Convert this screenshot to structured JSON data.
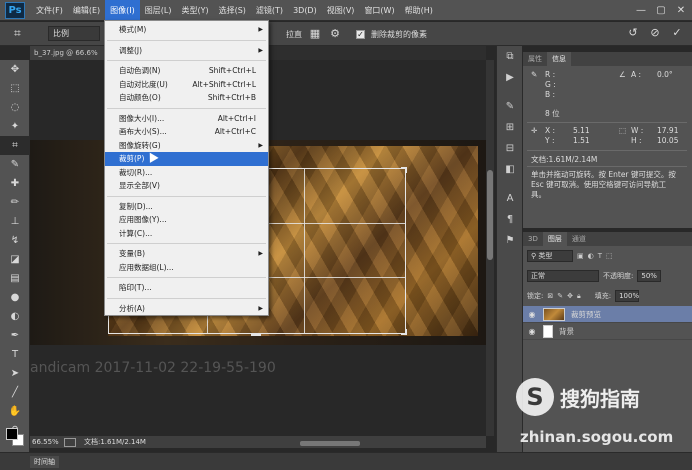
{
  "app": {
    "logo": "Ps"
  },
  "menubar": {
    "items": [
      "文件(F)",
      "编辑(E)",
      "图像(I)",
      "图层(L)",
      "类型(Y)",
      "选择(S)",
      "滤镜(T)",
      "3D(D)",
      "视图(V)",
      "窗口(W)",
      "帮助(H)"
    ],
    "active_index": 2
  },
  "options_bar": {
    "ratio_value": "比例",
    "straighten_label": "拉直",
    "delete_cropped_label": "删除裁剪的像素",
    "delete_cropped_checked": true
  },
  "document": {
    "tab_title": "b_37.jpg @ 66.6%",
    "zoom": "66.55%",
    "doc_info": "文档:1.61M/2.14M",
    "watermark_text": "andicam 2017-11-02 22-19-55-190"
  },
  "image_menu": {
    "items": [
      {
        "label": "模式(M)",
        "submenu": true
      },
      {
        "sep": true
      },
      {
        "label": "调整(J)",
        "submenu": true
      },
      {
        "sep": true
      },
      {
        "label": "自动色调(N)",
        "shortcut": "Shift+Ctrl+L"
      },
      {
        "label": "自动对比度(U)",
        "shortcut": "Alt+Shift+Ctrl+L"
      },
      {
        "label": "自动颜色(O)",
        "shortcut": "Shift+Ctrl+B"
      },
      {
        "sep": true
      },
      {
        "label": "图像大小(I)...",
        "shortcut": "Alt+Ctrl+I"
      },
      {
        "label": "画布大小(S)...",
        "shortcut": "Alt+Ctrl+C"
      },
      {
        "label": "图像旋转(G)",
        "submenu": true
      },
      {
        "label": "裁剪(P)",
        "highlighted": true
      },
      {
        "label": "裁切(R)..."
      },
      {
        "label": "显示全部(V)"
      },
      {
        "sep": true
      },
      {
        "label": "复制(D)..."
      },
      {
        "label": "应用图像(Y)..."
      },
      {
        "label": "计算(C)..."
      },
      {
        "sep": true
      },
      {
        "label": "变量(B)",
        "submenu": true
      },
      {
        "label": "应用数据组(L)..."
      },
      {
        "sep": true
      },
      {
        "label": "陷印(T)..."
      },
      {
        "sep": true
      },
      {
        "label": "分析(A)",
        "submenu": true
      }
    ]
  },
  "info_panel": {
    "tabs": [
      "属性",
      "信息"
    ],
    "active_tab": 1,
    "r_label": "R :",
    "g_label": "G :",
    "b_label": "B :",
    "a_label": "A :",
    "a_value": "0.0°",
    "bits": "8 位",
    "x_label": "X :",
    "x_value": "5.11",
    "y_label": "Y :",
    "y_value": "1.51",
    "w_label": "W :",
    "w_value": "17.91",
    "h_label": "H :",
    "h_value": "10.05",
    "doc_info": "文档:1.61M/2.14M",
    "hint": "单击并拖动可旋转。按 Enter 键可提交。按 Esc 键可取消。使用空格键可访问导航工具。"
  },
  "layers_panel": {
    "tabs": [
      "3D",
      "图层",
      "通道"
    ],
    "active_tab": 1,
    "filter_label": "类型",
    "blend_mode": "正常",
    "opacity_label": "不透明度:",
    "opacity_value": "50%",
    "lock_label": "锁定:",
    "fill_label": "填充:",
    "fill_value": "100%",
    "layers": [
      {
        "name": "裁剪预览",
        "selected": true
      },
      {
        "name": "背景",
        "selected": false
      }
    ]
  },
  "bottom": {
    "timeline_label": "时间轴"
  },
  "watermark": {
    "brand": "搜狗指南",
    "url": "zhinan.sogou.com"
  },
  "colors": {
    "accent": "#2f6fd1",
    "menu_bg": "#f0f0f0",
    "ui_dark": "#535353"
  }
}
